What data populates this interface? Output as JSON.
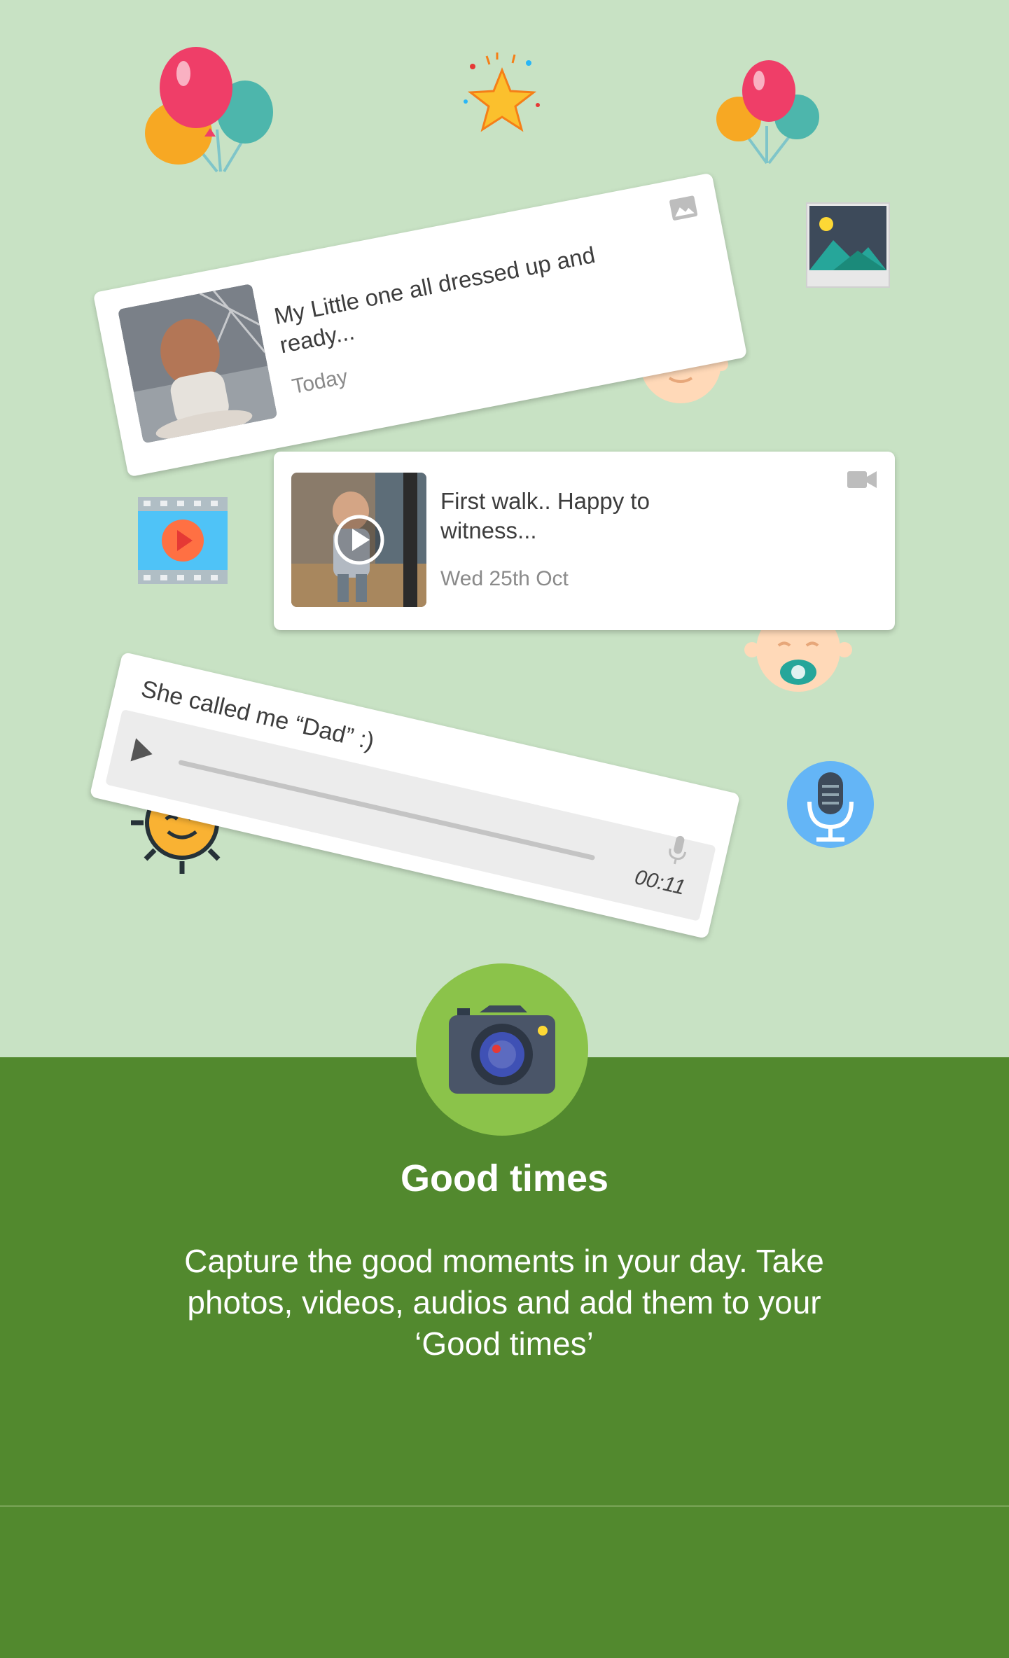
{
  "cards": [
    {
      "caption": "My Little one all dressed up and ready...",
      "date": "Today",
      "media_icon": "image-icon"
    },
    {
      "caption": "First walk.. Happy to witness...",
      "date": "Wed 25th Oct",
      "media_icon": "video-camera-icon"
    }
  ],
  "audio_card": {
    "caption": "She called me “Dad” :)",
    "duration": "00:11",
    "media_icon": "microphone-icon"
  },
  "onboarding": {
    "title": "Good times",
    "description": "Capture the good moments in your day. Take photos, videos, audios and add them to your ‘Good times’"
  },
  "colors": {
    "top_background": "#c8e2c4",
    "bottom_background": "#52892e",
    "camera_circle": "#8bc34a"
  }
}
